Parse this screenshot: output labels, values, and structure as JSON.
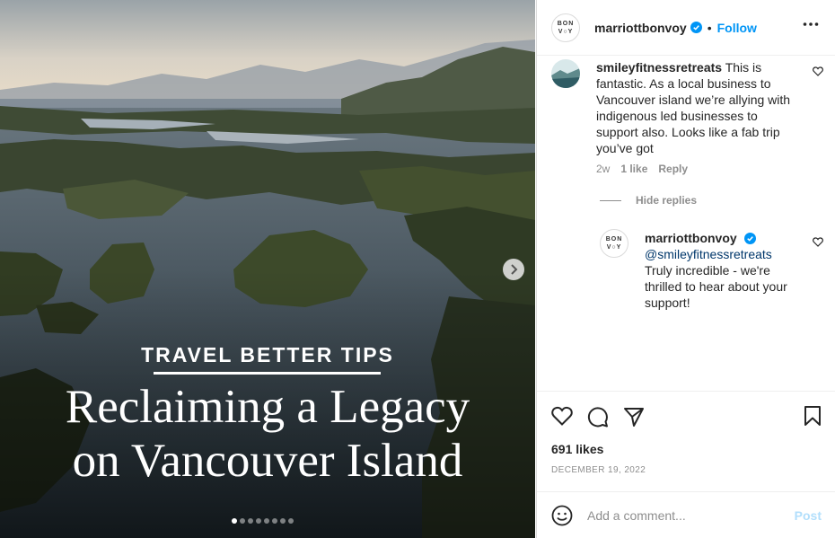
{
  "post": {
    "overlay": {
      "kicker": "TRAVEL BETTER TIPS",
      "title_line1": "Reclaiming a Legacy",
      "title_line2": "on Vancouver Island"
    },
    "carousel": {
      "count": 8,
      "active_index": 0
    }
  },
  "header": {
    "logo_line1": "BON",
    "logo_line2": "V",
    "logo_line3": "Y",
    "username": "marriottbonvoy",
    "separator": "•",
    "follow_label": "Follow"
  },
  "comments": [
    {
      "username": "smileyfitnessretreats",
      "text": "This is fantastic. As a local business to Vancouver island we’re allying with indigenous led businesses to support also. Looks like a fab trip you’ve got",
      "time": "2w",
      "likes": "1 like",
      "reply_label": "Reply"
    }
  ],
  "hide_replies_label": "Hide replies",
  "reply": {
    "username": "marriottbonvoy",
    "mention": "@smileyfitnessretreats",
    "text": "Truly incredible - we're thrilled to hear about your support!"
  },
  "likes": "691 likes",
  "date": "DECEMBER 19, 2022",
  "add_comment": {
    "placeholder": "Add a comment...",
    "post_label": "Post"
  },
  "colors": {
    "accent": "#0095f6",
    "post_disabled": "#b2dffc",
    "muted": "#8e8e8e",
    "mention": "#00376b"
  },
  "icons": [
    "chevron-right-icon",
    "verified-icon",
    "more-icon",
    "heart-icon",
    "comment-icon",
    "share-icon",
    "bookmark-icon",
    "emoji-icon"
  ]
}
